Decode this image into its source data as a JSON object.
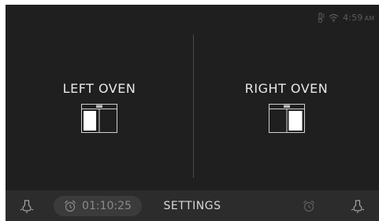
{
  "status": {
    "time": "4:59",
    "ampm": "AM",
    "icons": [
      "thermometer-icon",
      "wifi-icon"
    ]
  },
  "ovens": {
    "left": {
      "label": "LEFT OVEN",
      "icon": "left-oven-icon"
    },
    "right": {
      "label": "RIGHT OVEN",
      "icon": "right-oven-icon"
    }
  },
  "bottom_bar": {
    "timer_value": "01:10:25",
    "settings_label": "SETTINGS",
    "icons": [
      "light-bulb-icon",
      "alarm-clock-icon",
      "alarm-clock-icon",
      "light-bulb-icon"
    ]
  },
  "colors": {
    "background": "#1f1f1f",
    "bottom_bar": "#2c2c2c",
    "text_primary": "#e8e8e8",
    "text_muted": "#8a8a8a",
    "highlight": "#ffffff"
  }
}
